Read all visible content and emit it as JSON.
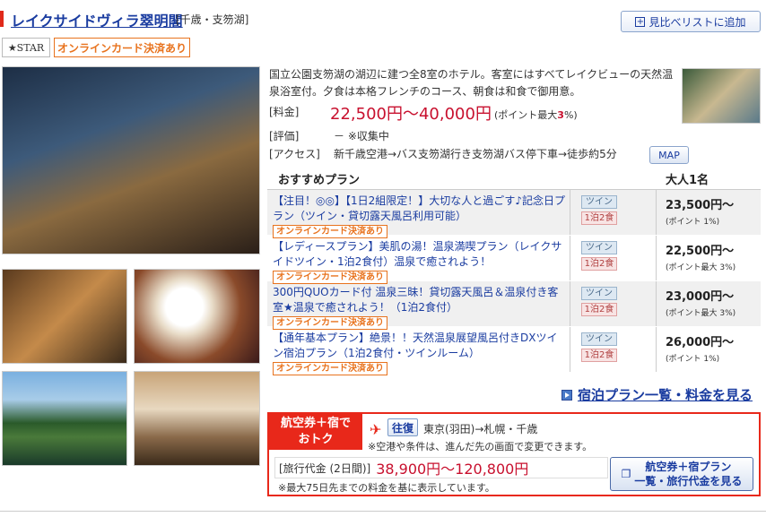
{
  "header": {
    "hotel_name": "レイクサイドヴィラ翠明閣",
    "area": "[千歳・支笏湖]",
    "compare_button": "見比べリストに追加"
  },
  "badges": {
    "star_logo": "★STAR",
    "online_card": "オンラインカード決済あり"
  },
  "description": {
    "text": "国立公園支笏湖の湖辺に建つ全8室のホテル。客室にはすべてレイクビューの天然温泉浴室付。夕食は本格フレンチのコース、朝食は和食で御用意。",
    "price_label": "[料金]",
    "price_value": "22,500円〜40,000円",
    "price_point_prefix": "(ポイント最大",
    "price_point_value": "3",
    "price_point_suffix": "%)",
    "eval_label": "[評価]",
    "eval_value": "－ ※収集中",
    "access_label": "[アクセス]",
    "access_value": "新千歳空港→バス支笏湖行き支笏湖バス停下車→徒歩約5分",
    "map_button": "MAP"
  },
  "plans": {
    "header_plan": "おすすめプラン",
    "header_price": "大人1名",
    "rows": [
      {
        "title": "【注目！◎◎】【1日2組限定！】大切な人と過ごす♪記念日プラン（ツイン・貸切露天風呂利用可能）",
        "badge": "オンラインカード決済あり",
        "room": "ツイン",
        "meal": "1泊2食",
        "price": "23,500円〜",
        "point": "(ポイント 1%)"
      },
      {
        "title": "【レディースプラン】美肌の湯！温泉満喫プラン（レイクサイドツイン・1泊2食付）温泉で癒されよう！",
        "badge": "オンラインカード決済あり",
        "room": "ツイン",
        "meal": "1泊2食",
        "price": "22,500円〜",
        "point": "(ポイント最大 3%)"
      },
      {
        "title": "300円QUOカード付 温泉三昧！貸切露天風呂＆温泉付き客室★温泉で癒されよう！（1泊2食付）",
        "badge": "オンラインカード決済あり",
        "room": "ツイン",
        "meal": "1泊2食",
        "price": "23,000円〜",
        "point": "(ポイント最大 3%)"
      },
      {
        "title": "【通年基本プラン】絶景！！天然温泉展望風呂付きDXツイン宿泊プラン（1泊2食付・ツインルーム）",
        "badge": "オンラインカード決済あり",
        "room": "ツイン",
        "meal": "1泊2食",
        "price": "26,000円〜",
        "point": "(ポイント 1%)"
      }
    ],
    "list_link": "宿泊プラン一覧・料金を見る"
  },
  "air": {
    "tag_line1": "航空券＋宿で",
    "tag_line2": "おトク",
    "round_trip": "往復",
    "route": "東京(羽田)→札幌・千歳",
    "route_note": "※空港や条件は、進んだ先の画面で変更できます。",
    "fare_label": "[旅行代金 (2日間)]",
    "fare_value": "38,900円〜120,800円",
    "fare_note": "※最大75日先までの料金を基に表示しています。",
    "button_line1": "航空券＋宿プラン",
    "button_line2": "一覧・旅行代金を見る"
  },
  "colors": {
    "accent_red": "#e8281a",
    "link_blue": "#1a3ca0",
    "badge_orange": "#e8731e"
  }
}
